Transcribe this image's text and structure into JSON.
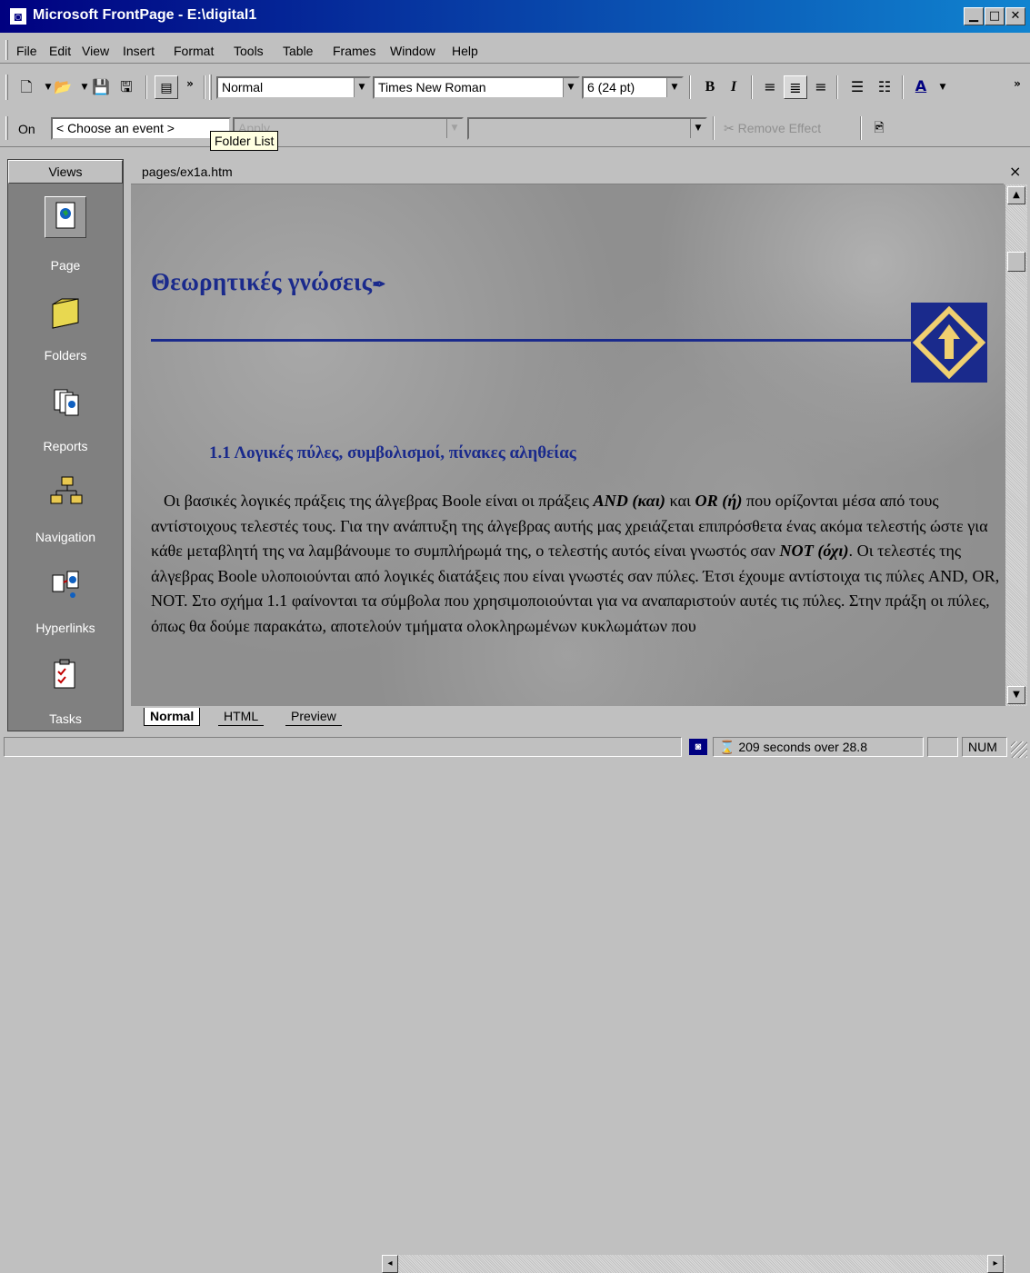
{
  "window": {
    "title": "Microsoft FrontPage - E:\\digital1",
    "minimize": "▁",
    "maximize": "□",
    "close": "✕"
  },
  "menu": [
    "File",
    "Edit",
    "View",
    "Insert",
    "Format",
    "Tools",
    "Table",
    "Frames",
    "Window",
    "Help"
  ],
  "toolbar": {
    "style_value": "Normal",
    "font_value": "Times New Roman",
    "size_value": "6  (24 pt)",
    "bold": "B",
    "italic": "I",
    "font_color": "A"
  },
  "dhtml": {
    "on_label": "On",
    "event_value": "< Choose an event >",
    "apply_value": "Apply",
    "remove_effect": "Remove Effect"
  },
  "tooltip": "Folder List",
  "views": {
    "header": "Views",
    "items": [
      "Page",
      "Folders",
      "Reports",
      "Navigation",
      "Hyperlinks",
      "Tasks"
    ]
  },
  "document": {
    "tab": "pages/ex1a.htm",
    "close": "×",
    "heading": "Θεωρητικές γνώσεις",
    "subheading": "1.1 Λογικές πύλες, συμβολισμοί, πίνακες αληθείας",
    "body_parts": {
      "p1": "Οι βασικές λογικές πράξεις της άλγεβρας Boole είναι οι πράξεις ",
      "and": "AND (και)",
      "p2": " και ",
      "or": "OR (ή)",
      "p3": " που ορίζονται μέσα από τους αντίστοιχους τελεστές τους. Για την ανάπτυξη της άλγεβρας αυτής μας χρειάζεται επιπρόσθετα ένας ακόμα τελεστής ώστε για κάθε μεταβλητή της να λαμβάνουμε το συμπλήρωμά της, ο τελεστής αυτός είναι γνωστός σαν ",
      "not": "NOT (όχι)",
      "p4": ". Οι τελεστές της άλγεβρας Boole υλοποιούνται από λογικές διατάξεις που είναι γνωστές σαν πύλες. Έτσι έχουμε αντίστοιχα τις πύλες AND, OR, NOT. Στο σχήμα 1.1 φαίνονται τα σύμβολα που χρησιμοποιούνται για να αναπαριστούν αυτές τις πύλες. Στην πράξη οι πύλες, όπως θα δούμε παρακάτω, αποτελούν τμήματα ολοκληρωμένων κυκλωμάτων που"
    }
  },
  "page_tabs": [
    "Normal",
    "HTML",
    "Preview"
  ],
  "status": {
    "time": "209 seconds over 28.8",
    "num": "NUM"
  },
  "colors": {
    "title_bar": "#000080",
    "heading": "#1a2a8c",
    "logo_arrow": "#f0d070"
  }
}
